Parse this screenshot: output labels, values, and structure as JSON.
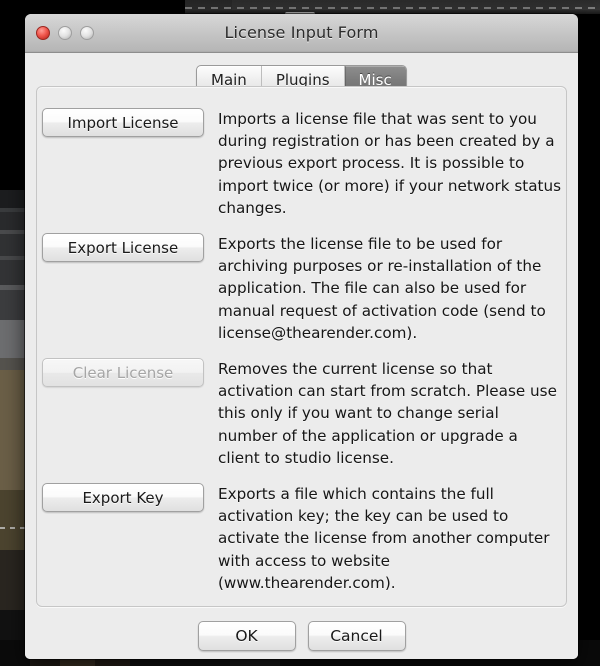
{
  "window": {
    "title": "License Input Form",
    "controls": [
      {
        "name": "close",
        "state": "active"
      },
      {
        "name": "minimize",
        "state": "disabled"
      },
      {
        "name": "zoom",
        "state": "disabled"
      }
    ]
  },
  "tabs": [
    {
      "label": "Main",
      "selected": false
    },
    {
      "label": "Plugins",
      "selected": false
    },
    {
      "label": "Misc",
      "selected": true
    }
  ],
  "rows": [
    {
      "button": "Import License",
      "disabled": false,
      "description": "Imports a license file that was sent to you during registration or has been created by a previous export process. It is possible to import twice (or more) if your network status changes."
    },
    {
      "button": "Export License",
      "disabled": false,
      "description": "Exports the license file to be used for archiving purposes or re-installation of the application. The file can also be used for manual request of activation code (send to license@thearender.com)."
    },
    {
      "button": "Clear License",
      "disabled": true,
      "description": "Removes the current license so that activation can start from scratch. Please use this only if you want to change serial number of the application or upgrade a client to studio license."
    },
    {
      "button": "Export Key",
      "disabled": false,
      "description": "Exports a file which contains the full activation key; the key can be used to activate the license from another computer with access to website (www.thearender.com)."
    }
  ],
  "footer": {
    "ok_label": "OK",
    "cancel_label": "Cancel"
  },
  "colors": {
    "window_bg": "#ececec",
    "titlebar_top": "#d8d8d8",
    "titlebar_bottom": "#a9a9a9",
    "tab_selected_bg": "#7c7c7c",
    "tab_selected_text": "#ffffff",
    "close_button": "#f0594f",
    "disabled_text": "#a6a6a6",
    "desktop_bg": "#000000"
  }
}
